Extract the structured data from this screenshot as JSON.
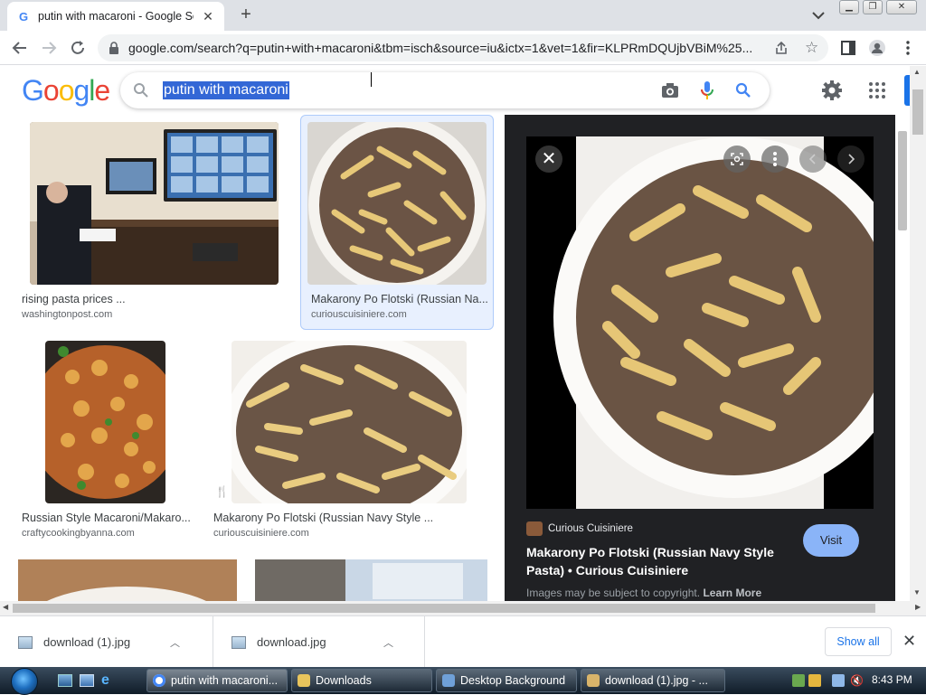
{
  "browser": {
    "tab_title": "putin with macaroni - Google Se",
    "favicon_letter": "G",
    "url": "google.com/search?q=putin+with+macaroni&tbm=isch&source=iu&ictx=1&vet=1&fir=KLPRmDQUjbVBiM%25..."
  },
  "google": {
    "logo": {
      "G": "G",
      "o1": "o",
      "o2": "o",
      "g": "g",
      "l": "l",
      "e": "e"
    },
    "query": "putin with macaroni"
  },
  "results": [
    {
      "title": "rising pasta prices ...",
      "source": "washingtonpost.com"
    },
    {
      "title": "Makarony Po Flotski (Russian Na...",
      "source": "curiouscuisiniere.com"
    },
    {
      "title": "Russian Style Macaroni/Makaro...",
      "source": "craftycookingbyanna.com"
    },
    {
      "title": "Makarony Po Flotski (Russian Navy Style ...",
      "source": "curiouscuisiniere.com"
    }
  ],
  "preview": {
    "source_name": "Curious Cuisiniere",
    "title": "Makarony Po Flotski (Russian Navy Style Pasta) • Curious Cuisiniere",
    "visit_label": "Visit",
    "copyright_text": "Images may be subject to copyright.",
    "learn_more": "Learn More"
  },
  "downloads": {
    "items": [
      "download (1).jpg",
      "download.jpg"
    ],
    "show_all": "Show all"
  },
  "taskbar": {
    "buttons": [
      "putin with macaroni...",
      "Downloads",
      "Desktop Background",
      "download (1).jpg - ..."
    ],
    "clock": "8:43 PM"
  },
  "colors": {
    "google_blue": "#4285f4",
    "google_red": "#ea4335",
    "google_yellow": "#fbbc05",
    "google_green": "#34a853",
    "visit_button": "#8ab4f8",
    "selection": "#3367d6"
  }
}
